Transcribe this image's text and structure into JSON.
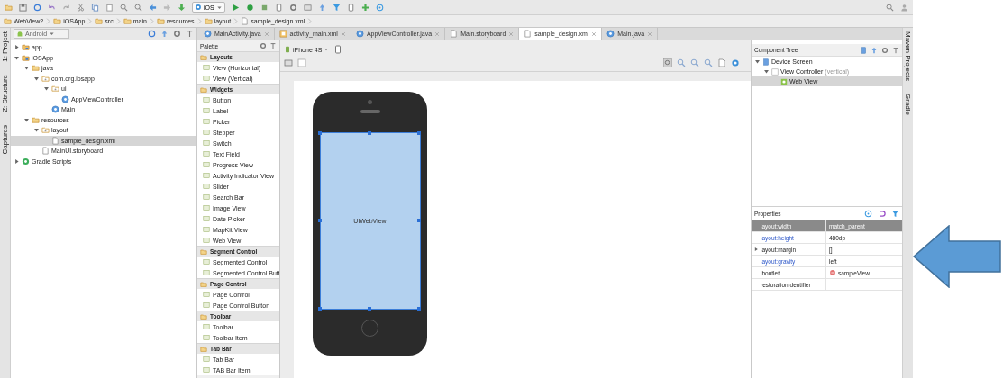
{
  "toolbar": {
    "platform": "iOS"
  },
  "breadcrumbs": [
    "WebView2",
    "iOSApp",
    "src",
    "main",
    "resources",
    "layout",
    "sample_design.xml"
  ],
  "left_strip": [
    "1: Project",
    "Z: Structure",
    "Captures"
  ],
  "project": {
    "view": "Android",
    "tree": [
      {
        "label": "app",
        "kind": "module",
        "expanded": false,
        "selected": false
      },
      {
        "label": "iOSApp",
        "kind": "module",
        "expanded": true,
        "selected": false,
        "children": [
          {
            "label": "java",
            "kind": "folder",
            "expanded": true,
            "selected": false,
            "children": [
              {
                "label": "com.org.iosapp",
                "kind": "package",
                "expanded": true,
                "selected": false,
                "children": [
                  {
                    "label": "ui",
                    "kind": "package",
                    "expanded": true,
                    "selected": false,
                    "children": [
                      {
                        "label": "AppViewController",
                        "kind": "class",
                        "selected": false
                      }
                    ]
                  },
                  {
                    "label": "Main",
                    "kind": "class",
                    "selected": false
                  }
                ]
              }
            ]
          },
          {
            "label": "resources",
            "kind": "folder",
            "expanded": true,
            "selected": false,
            "children": [
              {
                "label": "layout",
                "kind": "package",
                "expanded": true,
                "selected": false,
                "children": [
                  {
                    "label": "sample_design.xml",
                    "kind": "file",
                    "selected": true
                  }
                ]
              },
              {
                "label": "MainUI.storyboard",
                "kind": "file",
                "selected": false
              }
            ]
          }
        ]
      },
      {
        "label": "Gradle Scripts",
        "kind": "gradle",
        "expanded": false,
        "selected": false
      }
    ]
  },
  "tabs": [
    {
      "label": "MainActivity.java",
      "kind": "class",
      "selected": false
    },
    {
      "label": "activity_main.xml",
      "kind": "layout",
      "selected": false
    },
    {
      "label": "AppViewController.java",
      "kind": "class",
      "selected": false
    },
    {
      "label": "Main.storyboard",
      "kind": "file",
      "selected": false
    },
    {
      "label": "sample_design.xml",
      "kind": "file",
      "selected": true
    },
    {
      "label": "Main.java",
      "kind": "class",
      "selected": false
    }
  ],
  "palette": {
    "title": "Palette",
    "groups": [
      {
        "title": "Layouts",
        "items": [
          "View (Horizontal)",
          "View (Vertical)"
        ]
      },
      {
        "title": "Widgets",
        "items": [
          "Button",
          "Label",
          "Picker",
          "Stepper",
          "Switch",
          "Text Field",
          "Progress View",
          "Activity Indicator View",
          "Slider",
          "Search Bar",
          "Image View",
          "Date Picker",
          "MapKit View",
          "Web View"
        ]
      },
      {
        "title": "Segment Control",
        "items": [
          "Segmented Control",
          "Segmented Control Butt"
        ]
      },
      {
        "title": "Page Control",
        "items": [
          "Page Control",
          "Page Control Button"
        ]
      },
      {
        "title": "Toolbar",
        "items": [
          "Toolbar",
          "Toolbar Item"
        ]
      },
      {
        "title": "Tab Bar",
        "items": [
          "Tab Bar",
          "TAB Bar Item"
        ]
      }
    ]
  },
  "designer": {
    "device": "iPhone 4S",
    "webview_label": "UIWebView"
  },
  "component_tree": {
    "title": "Component Tree",
    "items": [
      {
        "label": "Device Screen",
        "expanded": true,
        "selected": false,
        "children": [
          {
            "label": "View Controller",
            "hint": "(vertical)",
            "expanded": true,
            "selected": false,
            "children": [
              {
                "label": "Web View",
                "selected": true
              }
            ]
          }
        ]
      }
    ]
  },
  "properties": {
    "title": "Properties",
    "rows": [
      {
        "name": "layout:width",
        "value": "match_parent",
        "kind": "plain",
        "modified": true,
        "selected": true
      },
      {
        "name": "layout:height",
        "value": "480dp",
        "kind": "plain",
        "modified": true,
        "selected": false
      },
      {
        "name": "layout:margin",
        "value": "[]",
        "kind": "group",
        "modified": false,
        "selected": false
      },
      {
        "name": "layout:gravity",
        "value": "left",
        "kind": "plain",
        "modified": true,
        "selected": false
      },
      {
        "name": "iboutlet",
        "value": "sampleView",
        "kind": "outlet",
        "modified": false,
        "selected": false
      },
      {
        "name": "restorationIdentifier",
        "kind": "plain",
        "modified": false,
        "selected": false
      }
    ]
  },
  "right_strip": [
    "Maven Projects",
    "Gradle"
  ]
}
